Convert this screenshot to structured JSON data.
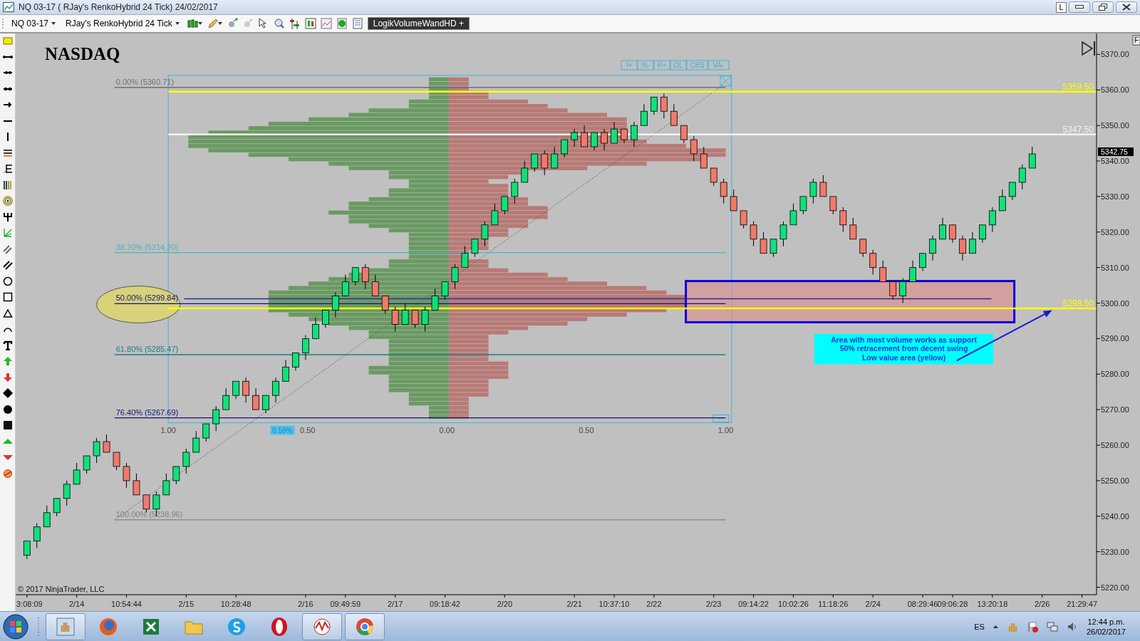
{
  "window": {
    "title": "NQ 03-17 ( RJay's RenkoHybrid  24 Tick)  24/02/2017",
    "link_button": "L"
  },
  "toolbar": {
    "instrument": "NQ 03-17",
    "bar_type": "RJay's RenkoHybrid  24 Tick",
    "indicator": "LogikVolumeWandHD +"
  },
  "chart": {
    "title": "NASDAQ",
    "copyright": "© 2017 NinjaTrader, LLC",
    "profile_buttons": [
      "I+",
      "%-",
      "R+",
      "OL",
      "CBS",
      "VA-"
    ],
    "profile_scale": [
      "1.00",
      "0.50",
      "0.00",
      "0.50",
      "1.00"
    ],
    "profile_marker": "0.59%",
    "last_price": "5342.75",
    "side_tab": "F",
    "note_lines": [
      "Area with most volume works as support",
      "50% retracement from decent swing",
      "Low value area (yellow)"
    ],
    "chart_data": {
      "type": "candlestick",
      "ylim": [
        5217.9,
        5375.9
      ],
      "categories": [
        "3:08:09",
        null,
        null,
        null,
        null,
        "2/14",
        null,
        null,
        null,
        null,
        "10:54:44",
        null,
        null,
        null,
        null,
        null,
        "2/15",
        null,
        null,
        null,
        null,
        "10:28:48",
        null,
        null,
        null,
        null,
        null,
        null,
        "2/16",
        null,
        null,
        null,
        "09:49:59",
        null,
        null,
        null,
        null,
        "2/17",
        null,
        null,
        null,
        null,
        "09:18:42",
        null,
        null,
        null,
        null,
        null,
        "2/20",
        null,
        null,
        null,
        null,
        null,
        null,
        "2/21",
        null,
        null,
        null,
        "10:37:10",
        null,
        null,
        null,
        "2/22",
        null,
        null,
        null,
        null,
        null,
        "2/23",
        null,
        null,
        null,
        "09:14:22",
        null,
        null,
        null,
        "10:02:26",
        null,
        null,
        null,
        "11:18:26",
        null,
        null,
        null,
        "2/24",
        null,
        null,
        null,
        null,
        "08:29:46",
        null,
        null,
        "09:06:28",
        null,
        null,
        null,
        "13:20:18",
        null,
        null,
        null,
        null,
        "2/26",
        null,
        null,
        null,
        "21:29:47"
      ],
      "ohlc": [
        [
          5229,
          5233,
          5228,
          5233
        ],
        [
          5233,
          5238,
          5231,
          5237
        ],
        [
          5237,
          5243,
          5237,
          5241
        ],
        [
          5241,
          5245,
          5240,
          5245
        ],
        [
          5245,
          5250,
          5243,
          5249
        ],
        [
          5249,
          5255,
          5249,
          5253
        ],
        [
          5253,
          5257,
          5252,
          5257
        ],
        [
          5257,
          5262,
          5255,
          5261
        ],
        [
          5261,
          5263,
          5258,
          5258
        ],
        [
          5258,
          5258,
          5253,
          5254
        ],
        [
          5254,
          5255,
          5248,
          5250
        ],
        [
          5250,
          5252,
          5246,
          5246
        ],
        [
          5246,
          5246,
          5241,
          5242
        ],
        [
          5242,
          5247,
          5240,
          5246
        ],
        [
          5246,
          5252,
          5246,
          5250
        ],
        [
          5250,
          5254,
          5249,
          5254
        ],
        [
          5254,
          5259,
          5252,
          5258
        ],
        [
          5258,
          5264,
          5258,
          5262
        ],
        [
          5262,
          5266,
          5261,
          5266
        ],
        [
          5266,
          5271,
          5264,
          5270
        ],
        [
          5270,
          5276,
          5270,
          5274
        ],
        [
          5274,
          5278,
          5273,
          5278
        ],
        [
          5278,
          5279,
          5272,
          5274
        ],
        [
          5274,
          5276,
          5270,
          5270
        ],
        [
          5270,
          5274,
          5269,
          5274
        ],
        [
          5274,
          5279,
          5272,
          5278
        ],
        [
          5278,
          5284,
          5278,
          5282
        ],
        [
          5282,
          5286,
          5281,
          5286
        ],
        [
          5286,
          5291,
          5284,
          5290
        ],
        [
          5290,
          5296,
          5290,
          5294
        ],
        [
          5294,
          5298,
          5293,
          5298
        ],
        [
          5298,
          5303,
          5296,
          5302
        ],
        [
          5302,
          5308,
          5302,
          5306
        ],
        [
          5306,
          5310,
          5305,
          5310
        ],
        [
          5310,
          5311,
          5304,
          5306
        ],
        [
          5306,
          5308,
          5302,
          5302
        ],
        [
          5302,
          5302,
          5297,
          5298
        ],
        [
          5298,
          5299,
          5292,
          5294
        ],
        [
          5294,
          5300,
          5294,
          5298
        ],
        [
          5298,
          5298,
          5293,
          5294
        ],
        [
          5294,
          5299,
          5292,
          5298
        ],
        [
          5298,
          5304,
          5298,
          5302
        ],
        [
          5302,
          5306,
          5301,
          5306
        ],
        [
          5306,
          5311,
          5304,
          5310
        ],
        [
          5310,
          5316,
          5310,
          5314
        ],
        [
          5314,
          5318,
          5313,
          5318
        ],
        [
          5318,
          5323,
          5316,
          5322
        ],
        [
          5322,
          5328,
          5322,
          5326
        ],
        [
          5326,
          5330,
          5325,
          5330
        ],
        [
          5330,
          5335,
          5328,
          5334
        ],
        [
          5334,
          5340,
          5334,
          5338
        ],
        [
          5338,
          5342,
          5337,
          5342
        ],
        [
          5342,
          5343,
          5336,
          5338
        ],
        [
          5338,
          5344,
          5338,
          5342
        ],
        [
          5342,
          5346,
          5341,
          5346
        ],
        [
          5346,
          5349,
          5344,
          5348
        ],
        [
          5348,
          5350,
          5344,
          5344
        ],
        [
          5344,
          5348,
          5343,
          5348
        ],
        [
          5348,
          5349,
          5343,
          5345
        ],
        [
          5345,
          5351,
          5345,
          5349
        ],
        [
          5349,
          5349,
          5345,
          5346
        ],
        [
          5346,
          5351,
          5344,
          5350
        ],
        [
          5350,
          5356,
          5350,
          5354
        ],
        [
          5354,
          5358,
          5353,
          5358
        ],
        [
          5358,
          5359,
          5352,
          5354
        ],
        [
          5354,
          5356,
          5350,
          5350
        ],
        [
          5350,
          5350,
          5345,
          5346
        ],
        [
          5346,
          5347,
          5340,
          5342
        ],
        [
          5342,
          5344,
          5338,
          5338
        ],
        [
          5338,
          5338,
          5333,
          5334
        ],
        [
          5334,
          5335,
          5328,
          5330
        ],
        [
          5330,
          5332,
          5326,
          5326
        ],
        [
          5326,
          5326,
          5321,
          5322
        ],
        [
          5322,
          5323,
          5316,
          5318
        ],
        [
          5318,
          5320,
          5314,
          5314
        ],
        [
          5314,
          5318,
          5313,
          5318
        ],
        [
          5318,
          5323,
          5316,
          5322
        ],
        [
          5322,
          5328,
          5322,
          5326
        ],
        [
          5326,
          5330,
          5325,
          5330
        ],
        [
          5330,
          5335,
          5328,
          5334
        ],
        [
          5334,
          5336,
          5330,
          5330
        ],
        [
          5330,
          5330,
          5325,
          5326
        ],
        [
          5326,
          5327,
          5320,
          5322
        ],
        [
          5322,
          5324,
          5318,
          5318
        ],
        [
          5318,
          5318,
          5313,
          5314
        ],
        [
          5314,
          5315,
          5308,
          5310
        ],
        [
          5310,
          5312,
          5306,
          5306
        ],
        [
          5306,
          5306,
          5301,
          5302
        ],
        [
          5302,
          5307,
          5300,
          5306
        ],
        [
          5306,
          5312,
          5306,
          5310
        ],
        [
          5310,
          5314,
          5309,
          5314
        ],
        [
          5314,
          5319,
          5312,
          5318
        ],
        [
          5318,
          5324,
          5318,
          5322
        ],
        [
          5322,
          5322,
          5317,
          5318
        ],
        [
          5318,
          5319,
          5312,
          5314
        ],
        [
          5314,
          5320,
          5314,
          5318
        ],
        [
          5318,
          5322,
          5317,
          5322
        ],
        [
          5322,
          5327,
          5320,
          5326
        ],
        [
          5326,
          5332,
          5326,
          5330
        ],
        [
          5330,
          5334,
          5329,
          5334
        ],
        [
          5334,
          5339,
          5332,
          5338
        ],
        [
          5338,
          5344,
          5338,
          5342
        ],
        null,
        null,
        null,
        null,
        null
      ],
      "yticks": [
        {
          "value": 5220,
          "label": "5220.00"
        },
        {
          "value": 5230,
          "label": "5230.00"
        },
        {
          "value": 5240,
          "label": "5240.00"
        },
        {
          "value": 5250,
          "label": "5250.00"
        },
        {
          "value": 5260,
          "label": "5260.00"
        },
        {
          "value": 5270,
          "label": "5270.00"
        },
        {
          "value": 5280,
          "label": "5280.00"
        },
        {
          "value": 5290,
          "label": "5290.00"
        },
        {
          "value": 5300,
          "label": "5300.00"
        },
        {
          "value": 5310,
          "label": "5310.00"
        },
        {
          "value": 5320,
          "label": "5320.00"
        },
        {
          "value": 5330,
          "label": "5330.00"
        },
        {
          "value": 5340,
          "label": "5340.00"
        },
        {
          "value": 5350,
          "label": "5350.00"
        },
        {
          "value": 5360,
          "label": "5360.00"
        },
        {
          "value": 5370,
          "label": "5370.00"
        }
      ],
      "ref_lines": [
        {
          "axis": "y",
          "value": 5347.5,
          "label": "5347.50",
          "color": "#f2f2f2"
        },
        {
          "axis": "y",
          "value": 5359.5,
          "label": "5359.50",
          "color": "#ffff00"
        },
        {
          "axis": "y",
          "value": 5298.5,
          "label": "5298.50",
          "color": "#ffff00"
        },
        {
          "axis": "y",
          "value": 5360.71,
          "label": "0.00% (5360.71)",
          "color": "#707070"
        },
        {
          "axis": "y",
          "value": 5314.2,
          "label": "38.20% (5314.20)",
          "color": "#48b4bc"
        },
        {
          "axis": "y",
          "value": 5299.84,
          "label": "50.00% (5299.84)",
          "color": "#141478"
        },
        {
          "axis": "y",
          "value": 5285.47,
          "label": "61.80% (5285.47)",
          "color": "#237c80"
        },
        {
          "axis": "y",
          "value": 5267.69,
          "label": "76.40% (5267.69)",
          "color": "#141478"
        },
        {
          "axis": "y",
          "value": 5238.96,
          "label": "100.00% (5238.96)",
          "color": "#808080"
        },
        {
          "axis": "y",
          "value": 5301.2,
          "color": "#2c2c90"
        }
      ]
    }
  },
  "taskbar": {
    "language": "ES",
    "time": "12:44 p.m.",
    "date": "26/02/2017"
  }
}
